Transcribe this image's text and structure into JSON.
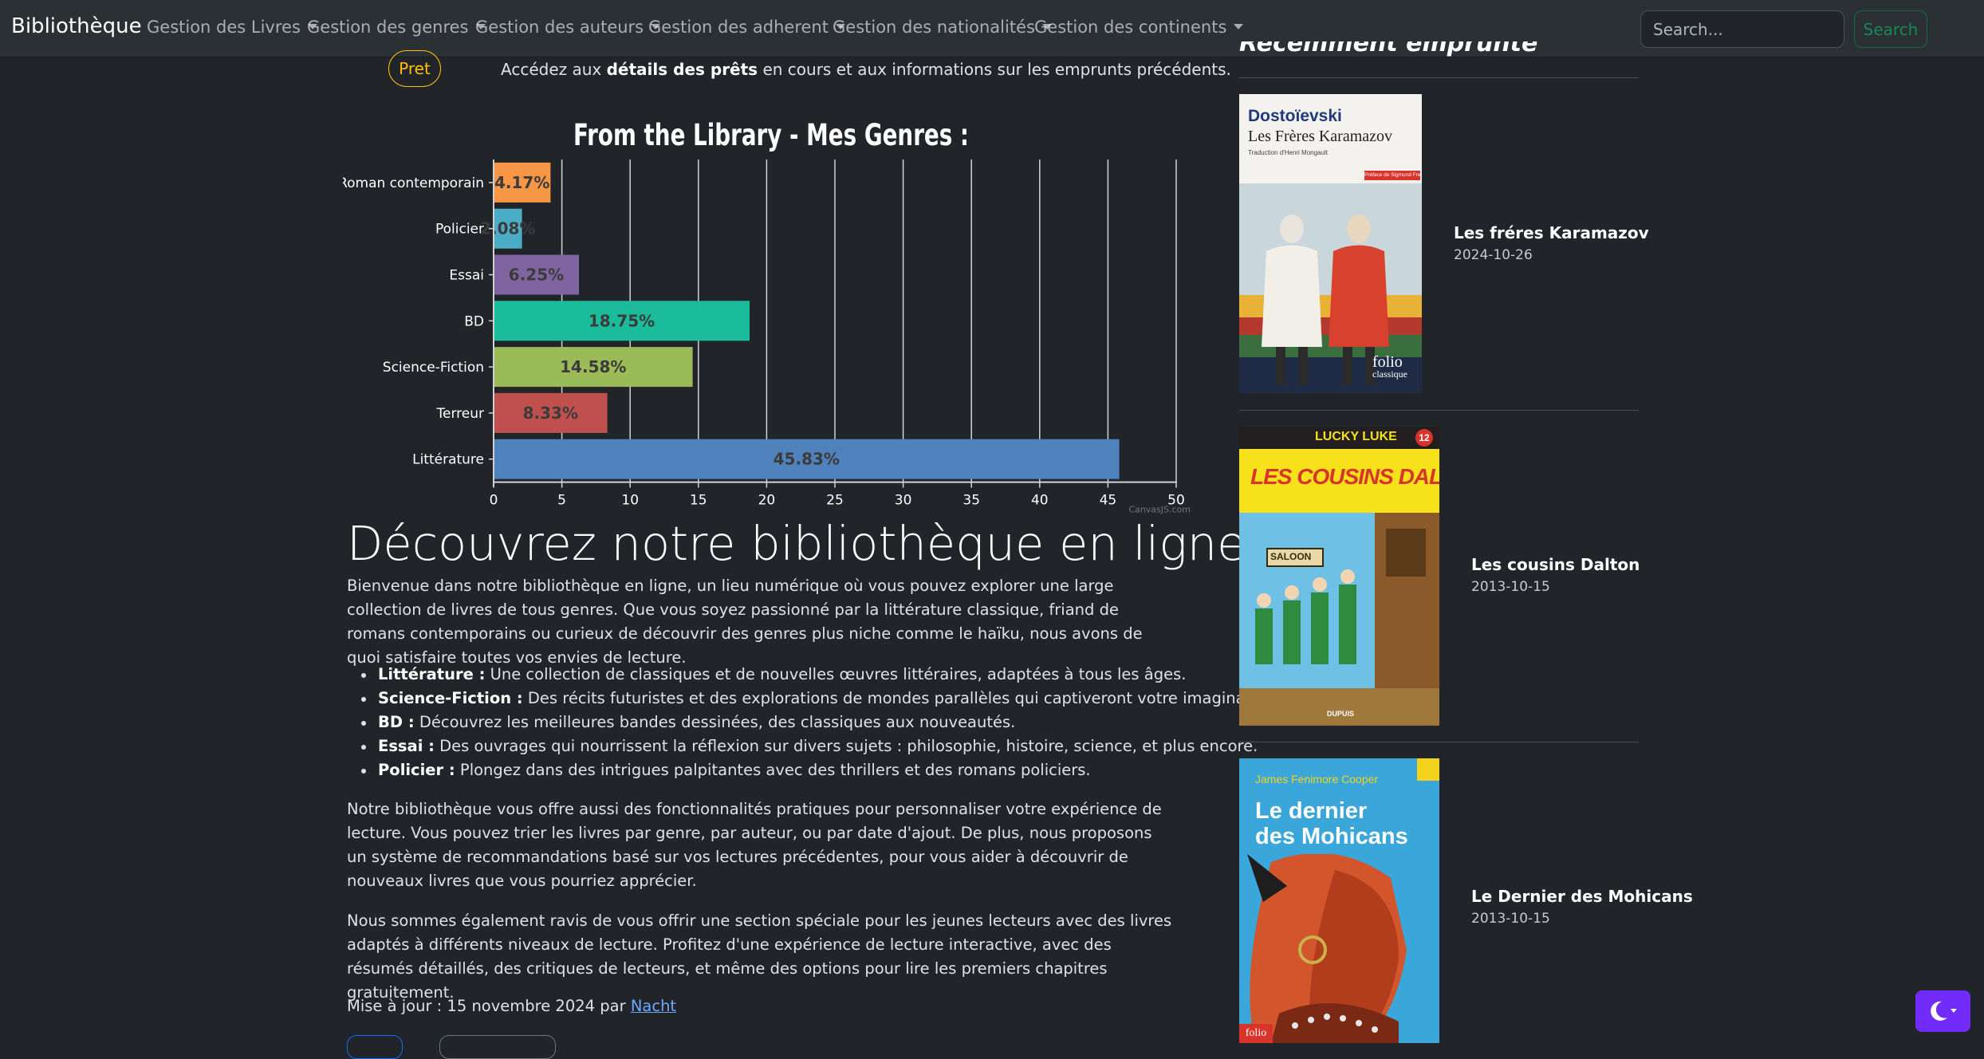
{
  "navbar": {
    "brand": "Bibliothèque",
    "items": [
      "Gestion des Livres",
      "Gestion des genres",
      "Gestion des auteurs",
      "Gestion des adherent",
      "Gestion des nationalités",
      "Gestion des continents"
    ],
    "search_placeholder": "Search...",
    "search_button": "Search"
  },
  "pret": {
    "label": "Pret",
    "text_before": "Accédez aux ",
    "text_bold": "détails des prêts",
    "text_after": " en cours et aux informations sur les emprunts précédents."
  },
  "chart_data": {
    "type": "bar",
    "orientation": "horizontal",
    "title": "From the Library - Mes Genres :",
    "categories": [
      "Roman contemporain",
      "Policier",
      "Essai",
      "BD",
      "Science-Fiction",
      "Terreur",
      "Littérature"
    ],
    "values": [
      4.17,
      2.08,
      6.25,
      18.75,
      14.58,
      8.33,
      45.83
    ],
    "value_labels": [
      "4.17%",
      "2.08%",
      "6.25%",
      "18.75%",
      "14.58%",
      "8.33%",
      "45.83%"
    ],
    "colors": [
      "#f79647",
      "#4bacc6",
      "#8064a2",
      "#1abc9c",
      "#9bbb59",
      "#c0504d",
      "#4f81bc"
    ],
    "xlim": [
      0,
      50
    ],
    "x_ticks": [
      0,
      5,
      10,
      15,
      20,
      25,
      30,
      35,
      40,
      45,
      50
    ],
    "grid": true,
    "credit": "CanvasJS.com"
  },
  "main": {
    "heading": "Découvrez notre bibliothèque en ligne",
    "intro": "Bienvenue dans notre bibliothèque en ligne, un lieu numérique où vous pouvez explorer une large collection de livres de tous genres. Que vous soyez passionné par la littérature classique, friand de romans contemporains ou curieux de découvrir des genres plus niche comme le haïku, nous avons de quoi satisfaire toutes vos envies de lecture.",
    "genres": [
      {
        "name": "Littérature :",
        "desc": " Une collection de classiques et de nouvelles œuvres littéraires, adaptées à tous les âges."
      },
      {
        "name": "Science-Fiction :",
        "desc": " Des récits futuristes et des explorations de mondes parallèles qui captiveront votre imagination."
      },
      {
        "name": "BD :",
        "desc": " Découvrez les meilleures bandes dessinées, des classiques aux nouveautés."
      },
      {
        "name": "Essai :",
        "desc": " Des ouvrages qui nourrissent la réflexion sur divers sujets : philosophie, histoire, science, et plus encore."
      },
      {
        "name": "Policier :",
        "desc": " Plongez dans des intrigues palpitantes avec des thrillers et des romans policiers."
      }
    ],
    "features": "Notre bibliothèque vous offre aussi des fonctionnalités pratiques pour personnaliser votre expérience de lecture. Vous pouvez trier les livres par genre, par auteur, ou par date d'ajout. De plus, nous proposons un système de recommandations basé sur vos lectures précédentes, pour vous aider à découvrir de nouveaux livres que vous pourriez apprécier.",
    "youth": "Nous sommes également ravis de vous offrir une section spéciale pour les jeunes lecteurs avec des livres adaptés à différents niveaux de lecture. Profitez d'une expérience de lecture interactive, avec des résumés détaillés, des critiques de lecteurs, et même des options pour lire les premiers chapitres gratuitement.",
    "updated_text": "Mise à jour : 15 novembre 2024 par ",
    "updated_author": "Nacht"
  },
  "recent": {
    "heading": "Récemment emprunté",
    "books": [
      {
        "title": "Les fréres Karamazov",
        "date": "2024-10-26",
        "cover": {
          "author": "Dostoïevski",
          "title": "Les Frères Karamazov",
          "translator": "Traduction d'Henri Mongault",
          "preface": "Préface de Sigmund Freud",
          "publisher": "folio",
          "collection": "classique"
        }
      },
      {
        "title": "Les cousins Dalton",
        "date": "2013-10-15",
        "cover": {
          "series": "LUCKY LUKE",
          "number": "12",
          "title": "LES COUSINS DALTON",
          "sign": "SALOON",
          "publisher": "DUPUIS"
        }
      },
      {
        "title": "Le Dernier des Mohicans",
        "date": "2013-10-15",
        "cover": {
          "author": "James Fenimore Cooper",
          "title_line1": "Le dernier",
          "title_line2": "des Mohicans",
          "publisher": "folio"
        }
      }
    ]
  },
  "theme_toggle_icon": "moon-icon"
}
